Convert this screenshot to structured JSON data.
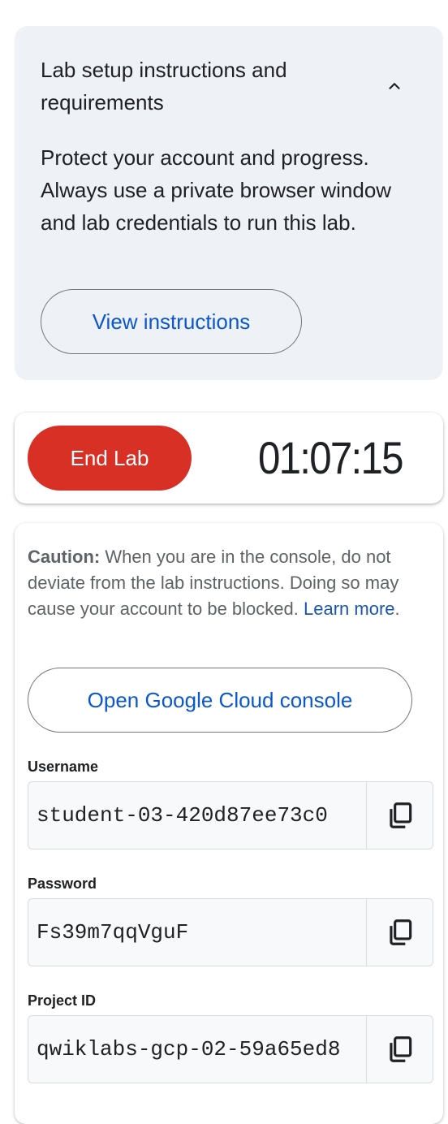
{
  "setup": {
    "title": "Lab setup instructions and requirements",
    "body": "Protect your account and progress. Always use a private browser window and lab credentials to run this lab.",
    "view_button": "View instructions",
    "collapse_icon": "chevron-up-icon"
  },
  "timer_bar": {
    "end_button": "End Lab",
    "time_remaining": "01:07:15",
    "end_button_color": "#d93025"
  },
  "credentials": {
    "caution_label": "Caution:",
    "caution_text": " When you are in the console, do not deviate from the lab instructions. Doing so may cause your account to be blocked. ",
    "learn_more": "Learn more",
    "learn_more_suffix": ".",
    "console_button": "Open Google Cloud console",
    "fields": [
      {
        "label": "Username",
        "value": "student-03-420d87ee73c0",
        "icon": "copy-icon"
      },
      {
        "label": "Password",
        "value": "Fs39m7qqVguF",
        "icon": "copy-icon"
      },
      {
        "label": "Project ID",
        "value": "qwiklabs-gcp-02-59a65ed8",
        "icon": "copy-icon"
      }
    ]
  },
  "colors": {
    "accent_link": "#0b57d0",
    "card_background": "#eef1f6"
  }
}
